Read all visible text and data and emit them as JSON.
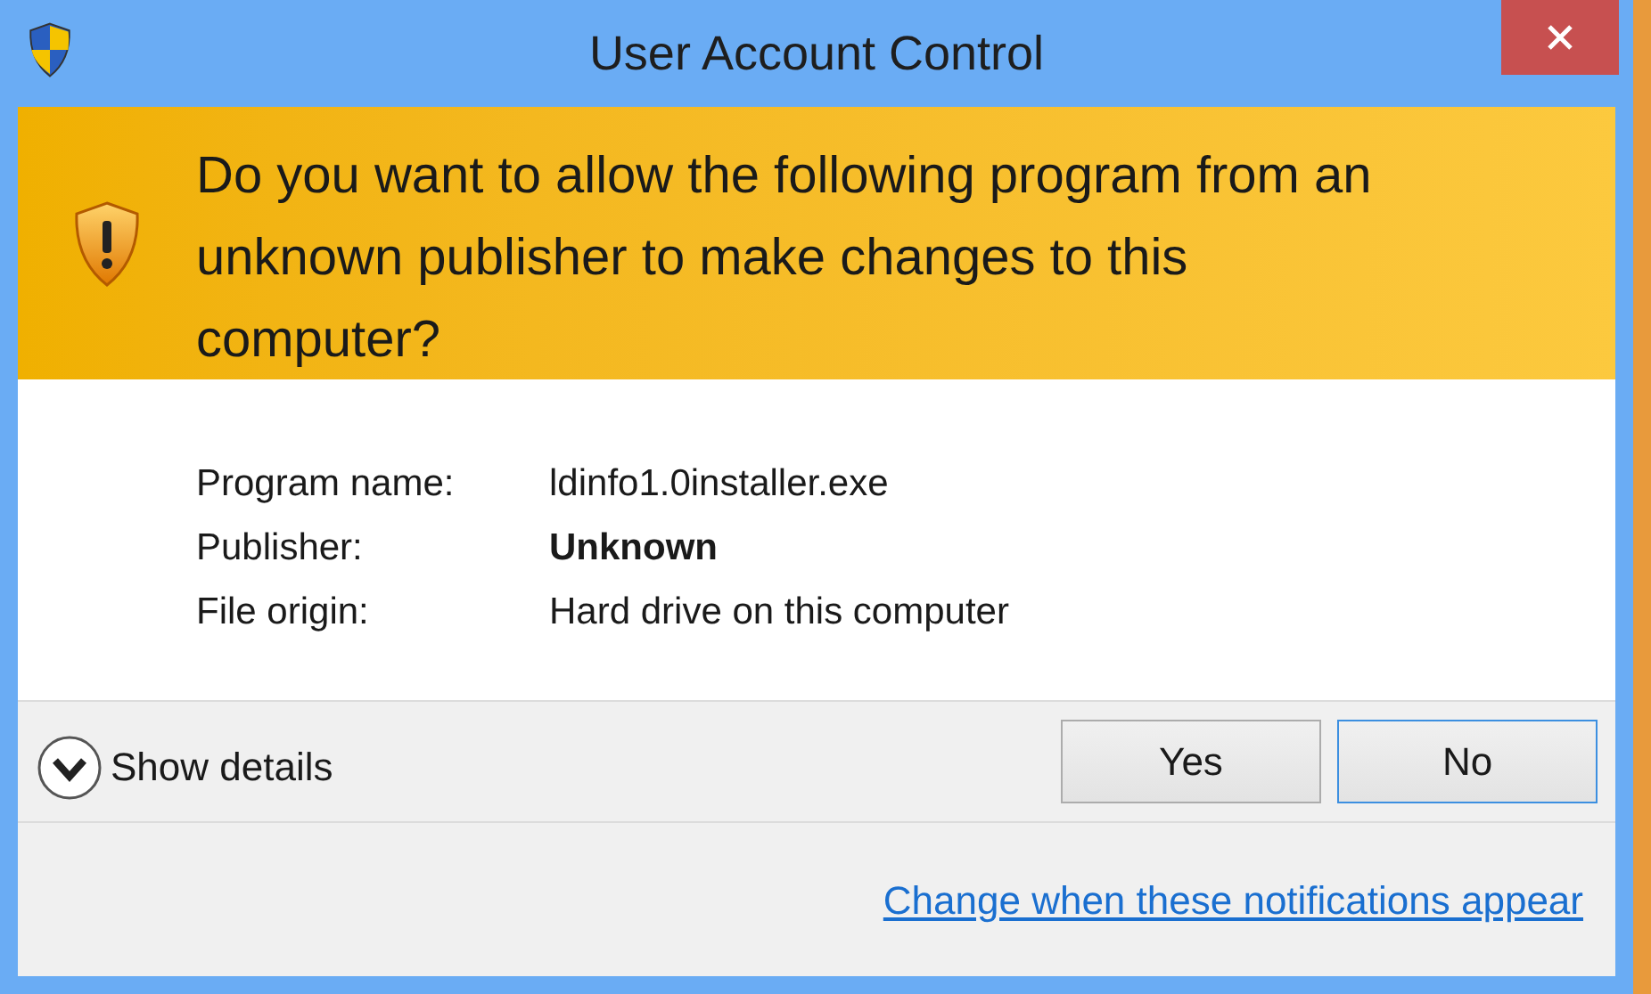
{
  "window": {
    "title": "User Account Control"
  },
  "question": "Do you want to allow the following program from an unknown publisher to make changes to this computer?",
  "details": [
    {
      "label": "Program name:",
      "value": "ldinfo1.0installer.exe",
      "bold": false
    },
    {
      "label": "Publisher:",
      "value": "Unknown",
      "bold": true
    },
    {
      "label": "File origin:",
      "value": "Hard drive on this computer",
      "bold": false
    }
  ],
  "show_details": {
    "label": "Show details",
    "expanded": false
  },
  "buttons": [
    {
      "label": "Yes",
      "focused": false
    },
    {
      "label": "No",
      "focused": true
    }
  ],
  "link": "Change when these notifications appear"
}
